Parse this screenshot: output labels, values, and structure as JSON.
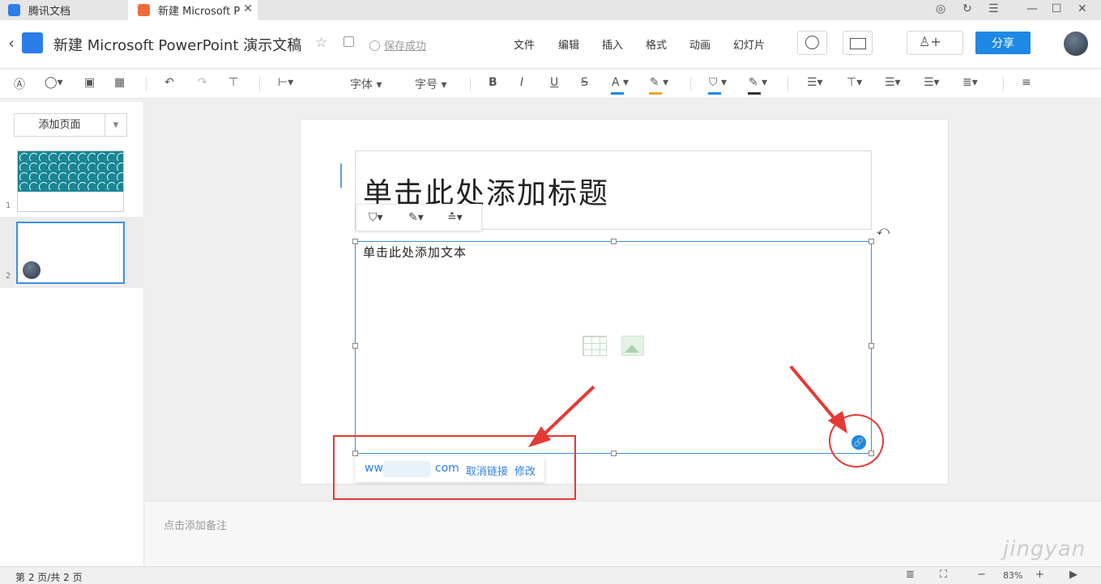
{
  "tabs": [
    {
      "label": "腾讯文档"
    },
    {
      "label": "新建 Microsoft P"
    }
  ],
  "header": {
    "title": "新建 Microsoft PowerPoint 演示文稿",
    "save_status": "保存成功",
    "menu": [
      "文件",
      "编辑",
      "插入",
      "格式",
      "动画",
      "幻灯片"
    ],
    "share_label": "分享"
  },
  "toolbar": {
    "font_label": "字体",
    "size_label": "字号",
    "bold": "B",
    "italic": "I",
    "underline": "U",
    "strike": "S",
    "font_color_glyph": "A",
    "font_color": "#1e88e5",
    "highlight_color": "#f0a22e",
    "fill_color": "#1e88e5",
    "border_color": "#333333"
  },
  "sidebar": {
    "add_page_label": "添加页面",
    "slides": [
      {
        "number": "1"
      },
      {
        "number": "2"
      }
    ]
  },
  "slide": {
    "title_placeholder": "单击此处添加标题",
    "body_placeholder": "单击此处添加文本"
  },
  "link_popup": {
    "url_prefix": "ww",
    "url_suffix": "com",
    "unlink_label": "取消链接",
    "edit_label": "修改"
  },
  "notes": {
    "placeholder": "点击添加备注"
  },
  "status": {
    "page_info": "第 2 页/共 2 页",
    "zoom": "83%"
  },
  "watermark": "jingyan"
}
